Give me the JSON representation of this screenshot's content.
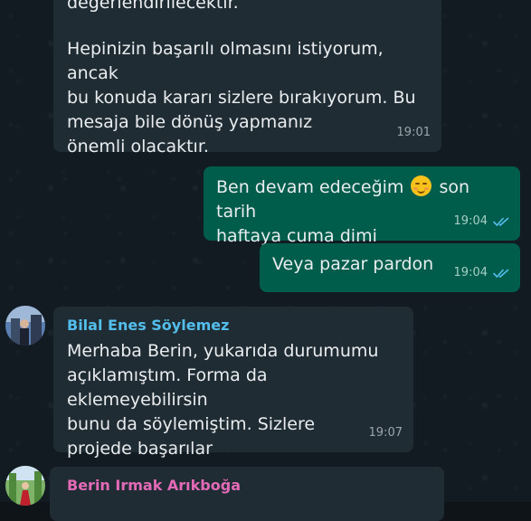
{
  "messages": [
    {
      "text_top": "değerlendirilecektir.",
      "text_main": "Hepinizin başarılı olmasını istiyorum, ancak\nbu konuda kararı sizlere bırakıyorum. Bu\nmesaja bile dönüş yapmanız\nönemli olacaktır.",
      "time": "19:01"
    },
    {
      "text_before_emoji": "Ben devam edeceğim",
      "emoji": "relieved-face",
      "text_after_emoji": "son tarih\nhaftaya cuma dimi",
      "time": "19:04",
      "status": "read"
    },
    {
      "text": "Veya pazar pardon",
      "time": "19:04",
      "status": "read"
    },
    {
      "sender": "Bilal Enes Söylemez",
      "sender_color": "#53bdeb",
      "text": "Merhaba Berin, yukarıda durumumu\naçıklamıştım. Forma da eklemeyebilirsin\nbunu da söylemiştim. Sizlere\nprojede başarılar",
      "time": "19:07"
    },
    {
      "sender": "Berin Irmak Arıkboğa",
      "sender_color": "#e26ab6"
    }
  ],
  "colors": {
    "incoming_bubble": "#202c33",
    "outgoing_bubble": "#005c4b",
    "read_ticks": "#53bdeb"
  }
}
